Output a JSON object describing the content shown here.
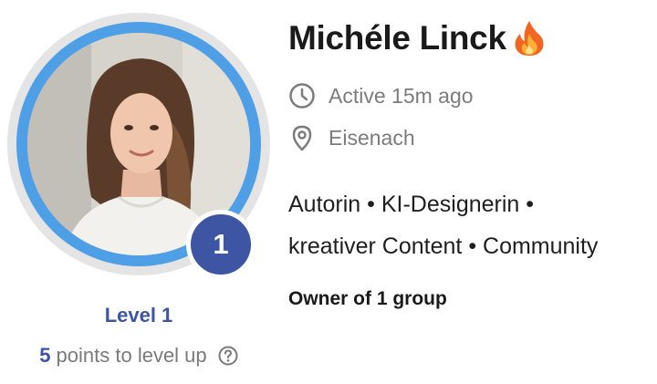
{
  "profile": {
    "name": "Michéle Linck",
    "status_icon": "fire-icon",
    "active_text": "Active 15m ago",
    "location": "Eisenach",
    "bio_line1": "Autorin • KI-Designerin •",
    "bio_line2": "kreativer Content • Community",
    "owner_text": "Owner of 1 group"
  },
  "level": {
    "badge_number": "1",
    "label": "Level 1",
    "points_count": "5",
    "points_suffix": " points to level up",
    "help_icon": "question-circle-icon"
  },
  "colors": {
    "level_blue": "#3d55a3",
    "ring_blue": "#4f9fe6",
    "ring_gray": "#e4e4e4",
    "muted_text": "#7c7c7c"
  }
}
